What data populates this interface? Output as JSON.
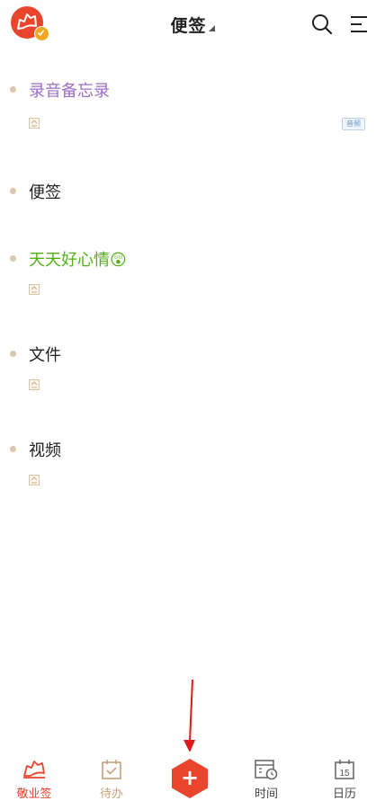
{
  "header": {
    "title": "便签",
    "avatar_icon": "cloud-logo-icon",
    "badge_icon": "vip-check-badge-icon",
    "search_icon": "search-icon",
    "menu_icon": "menu-icon"
  },
  "notes": [
    {
      "title": "录音备忘录",
      "title_color": "#9e6fc5",
      "meta_icon": "note-paper-icon",
      "tag": "音频"
    },
    {
      "title": "便签",
      "title_color": "#1f1f1f"
    },
    {
      "title": "天天好心情😲",
      "title_color": "#52b116",
      "meta_icon": "note-paper-icon"
    },
    {
      "title": "文件",
      "title_color": "#1f1f1f",
      "meta_icon": "note-paper-icon"
    },
    {
      "title": "视频",
      "title_color": "#1f1f1f",
      "meta_icon": "note-paper-icon"
    }
  ],
  "bottom_nav": {
    "items": [
      {
        "label": "敬业签",
        "icon": "cloud-logo-icon",
        "active": true
      },
      {
        "label": "待办",
        "icon": "todo-checkbox-icon",
        "active": false
      },
      {
        "label": "",
        "icon": "add-icon",
        "active": false
      },
      {
        "label": "时间",
        "icon": "time-calendar-clock-icon",
        "active": false
      },
      {
        "label": "日历",
        "icon": "calendar-icon",
        "active": false,
        "icon_text": "15"
      }
    ],
    "add_symbol": "+"
  },
  "colors": {
    "accent": "#e8452c",
    "dot": "#d8c8ae",
    "inactive_icon": "#c4a27a",
    "annotation_arrow": "#e0191c"
  }
}
